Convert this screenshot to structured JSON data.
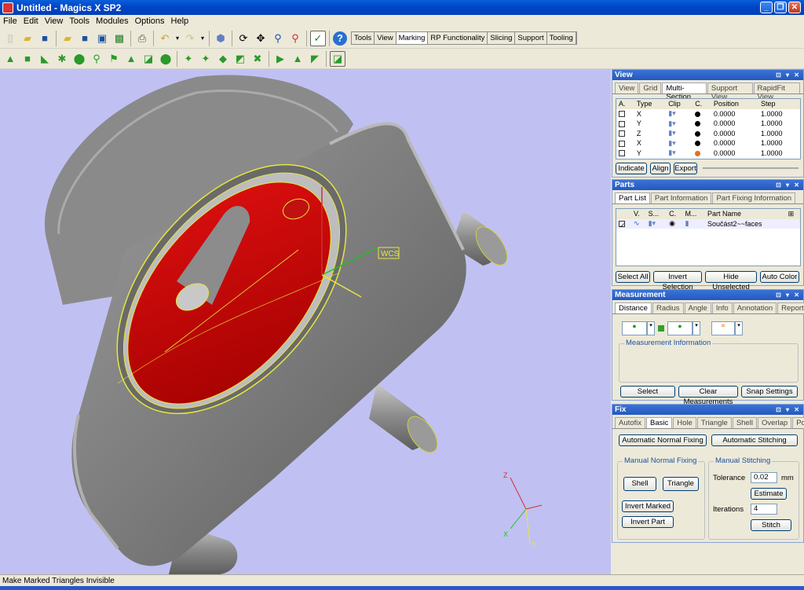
{
  "window": {
    "title": "Untitled - Magics X SP2",
    "minimize": "_",
    "maximize": "❐",
    "close": "✕"
  },
  "menu": [
    "File",
    "Edit",
    "View",
    "Tools",
    "Modules",
    "Options",
    "Help"
  ],
  "toolbar_tabs": [
    {
      "label": "Tools",
      "active": false
    },
    {
      "label": "View",
      "active": false
    },
    {
      "label": "Marking",
      "active": true
    },
    {
      "label": "RP Functionality",
      "active": false
    },
    {
      "label": "Slicing",
      "active": false
    },
    {
      "label": "Support",
      "active": false
    },
    {
      "label": "Tooling",
      "active": false
    }
  ],
  "viewport": {
    "wcs_label": "WCS",
    "axis_z": "Z",
    "axis_x": "X",
    "axis_y": "Y",
    "background": "#c0c1f2"
  },
  "view_panel": {
    "title": "View",
    "tabs": [
      "View",
      "Grid",
      "Multi-Section",
      "Support View",
      "RapidFit View"
    ],
    "active_tab": 2,
    "columns": [
      "A.",
      "Type",
      "Clip",
      "C.",
      "Position",
      "Step"
    ],
    "rows": [
      {
        "type": "X",
        "position": "0.0000",
        "step": "1.0000",
        "color": "#000000"
      },
      {
        "type": "Y",
        "position": "0.0000",
        "step": "1.0000",
        "color": "#000000"
      },
      {
        "type": "Z",
        "position": "0.0000",
        "step": "1.0000",
        "color": "#000000"
      },
      {
        "type": "X",
        "position": "0.0000",
        "step": "1.0000",
        "color": "#000000"
      },
      {
        "type": "Y",
        "position": "0.0000",
        "step": "1.0000",
        "color": "#e07020"
      }
    ],
    "buttons": {
      "indicate": "Indicate",
      "align": "Align",
      "export": "Export"
    }
  },
  "parts_panel": {
    "title": "Parts",
    "tabs": [
      "Part List",
      "Part Information",
      "Part Fixing Information"
    ],
    "active_tab": 0,
    "columns": [
      "V.",
      "S...",
      "C.",
      "M...",
      "Part Name"
    ],
    "rows": [
      {
        "name": "Součást2~~faces"
      }
    ],
    "buttons": {
      "select_all": "Select All",
      "invert_selection": "Invert Selection",
      "hide_unselected": "Hide Unselected",
      "auto_color": "Auto Color"
    }
  },
  "measurement_panel": {
    "title": "Measurement",
    "tabs": [
      "Distance",
      "Radius",
      "Angle",
      "Info",
      "Annotation",
      "Report"
    ],
    "active_tab": 0,
    "info_label": "Measurement Information",
    "buttons": {
      "select": "Select",
      "clear": "Clear Measurements",
      "snap": "Snap Settings"
    }
  },
  "fix_panel": {
    "title": "Fix",
    "tabs": [
      "Autofix",
      "Basic",
      "Hole",
      "Triangle",
      "Shell",
      "Overlap",
      "Point"
    ],
    "active_tab": 1,
    "buttons": {
      "auto_normal": "Automatic Normal Fixing",
      "auto_stitch": "Automatic Stitching",
      "shell": "Shell",
      "triangle": "Triangle",
      "invert_marked": "Invert Marked",
      "invert_part": "Invert Part",
      "estimate": "Estimate",
      "stitch": "Stitch"
    },
    "manual_normal_label": "Manual Normal Fixing",
    "manual_stitch_label": "Manual Stitching",
    "tolerance_label": "Tolerance",
    "tolerance_value": "0.02",
    "tolerance_unit": "mm",
    "iterations_label": "Iterations",
    "iterations_value": "4"
  },
  "status": {
    "text": "Make Marked Triangles Invisible"
  }
}
